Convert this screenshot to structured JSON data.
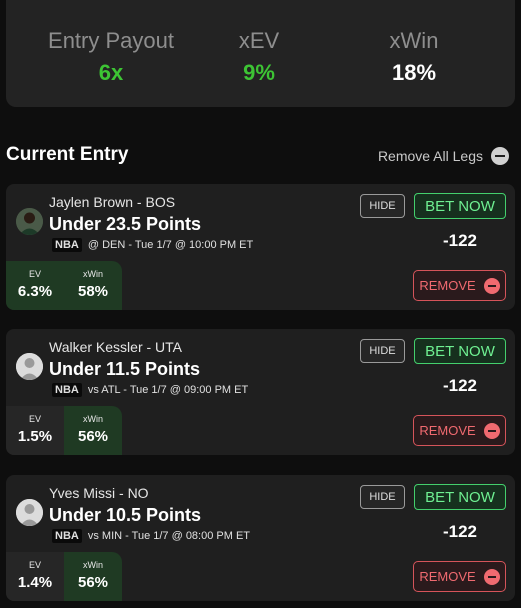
{
  "summary": {
    "entry_payout": {
      "label": "Entry Payout",
      "value": "6x"
    },
    "xev": {
      "label": "xEV",
      "value": "9%"
    },
    "xwin": {
      "label": "xWin",
      "value": "18%"
    }
  },
  "current_entry": {
    "title": "Current Entry",
    "remove_all_label": "Remove All Legs"
  },
  "legs": [
    {
      "player": "Jaylen Brown - BOS",
      "line": "Under 23.5 Points",
      "league": "NBA",
      "game": "@ DEN - Tue 1/7 @ 10:00 PM ET",
      "ev_label": "EV",
      "ev": "6.3%",
      "xwin_label": "xWin",
      "xwin": "58%",
      "odds": "-122",
      "hide_label": "HIDE",
      "bet_label": "BET NOW",
      "remove_label": "REMOVE"
    },
    {
      "player": "Walker Kessler - UTA",
      "line": "Under 11.5 Points",
      "league": "NBA",
      "game": "vs ATL - Tue 1/7 @ 09:00 PM ET",
      "ev_label": "EV",
      "ev": "1.5%",
      "xwin_label": "xWin",
      "xwin": "56%",
      "odds": "-122",
      "hide_label": "HIDE",
      "bet_label": "BET NOW",
      "remove_label": "REMOVE"
    },
    {
      "player": "Yves Missi - NO",
      "line": "Under 10.5 Points",
      "league": "NBA",
      "game": "vs MIN - Tue 1/7 @ 08:00 PM ET",
      "ev_label": "EV",
      "ev": "1.4%",
      "xwin_label": "xWin",
      "xwin": "56%",
      "odds": "-122",
      "hide_label": "HIDE",
      "bet_label": "BET NOW",
      "remove_label": "REMOVE"
    }
  ]
}
